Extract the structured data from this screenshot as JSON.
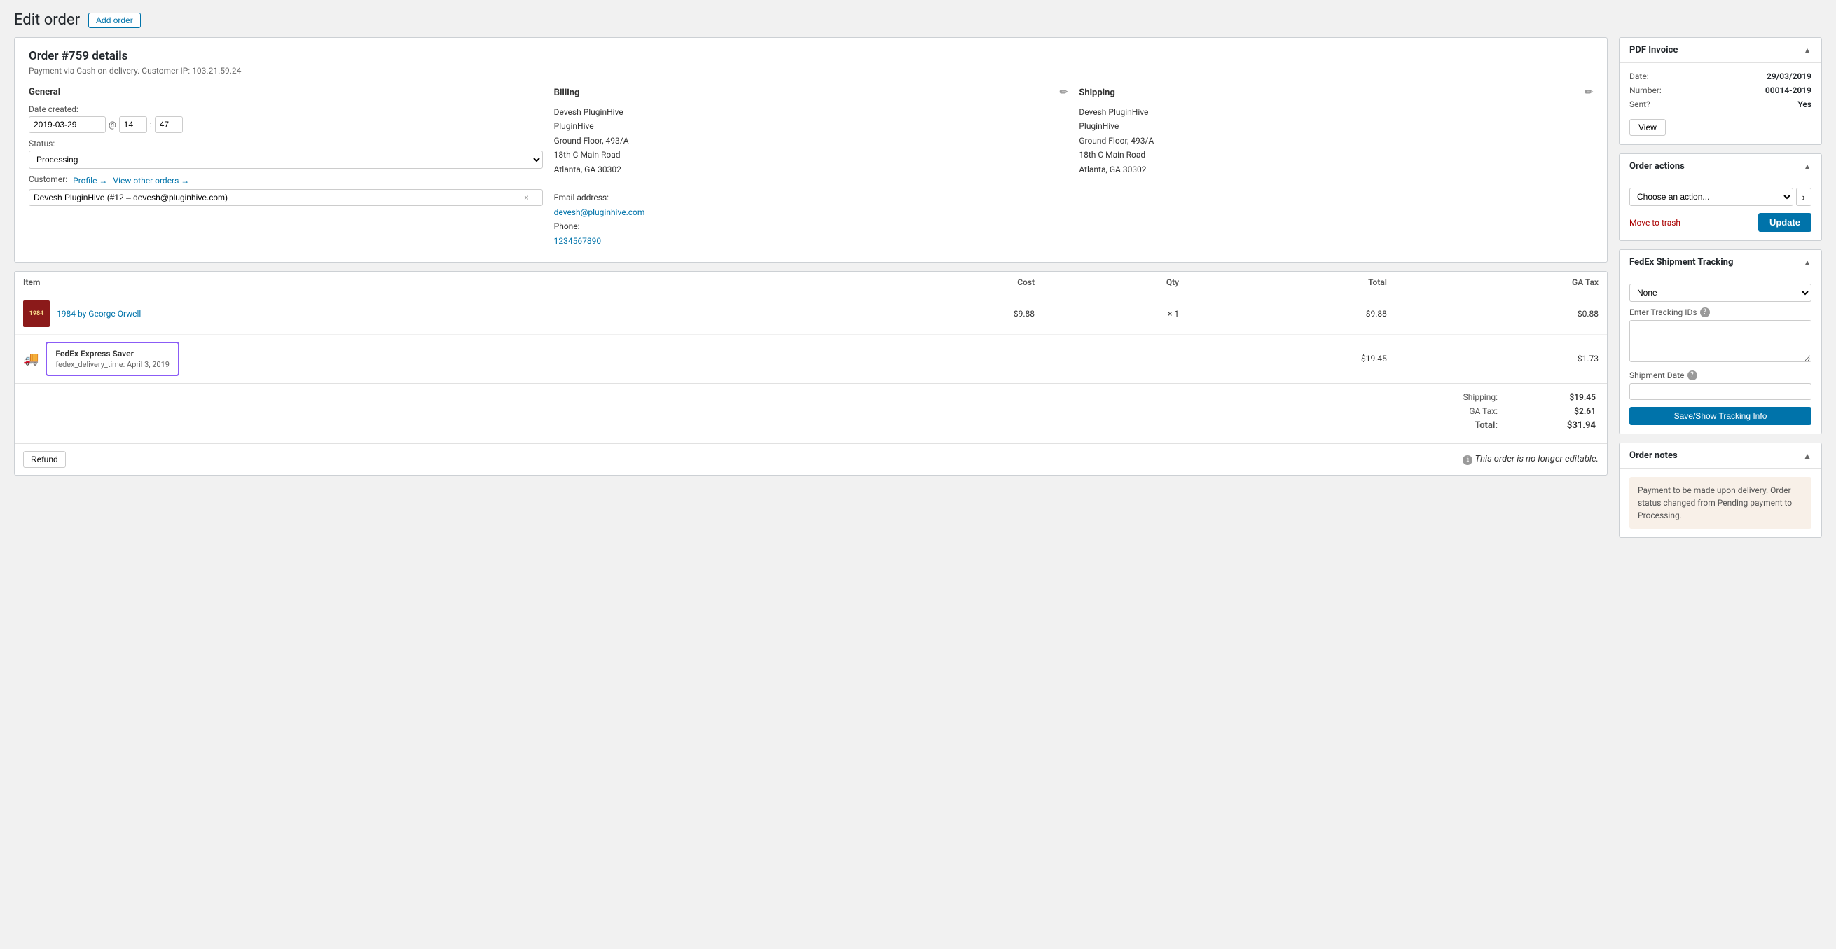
{
  "page": {
    "title": "Edit order",
    "add_order_btn": "Add order"
  },
  "order": {
    "title": "Order #759 details",
    "subtitle": "Payment via Cash on delivery. Customer IP: 103.21.59.24",
    "general": {
      "label": "General",
      "date_label": "Date created:",
      "date_value": "2019-03-29",
      "time_h": "14",
      "time_m": "47",
      "status_label": "Status:",
      "status_value": "Processing",
      "customer_label": "Customer:",
      "profile_link": "Profile →",
      "view_orders_link": "View other orders →",
      "customer_value": "Devesh PluginHive (#12 – devesh@pluginhive.com)"
    },
    "billing": {
      "label": "Billing",
      "name": "Devesh PluginHive",
      "company": "PluginHive",
      "address1": "Ground Floor, 493/A",
      "address2": "18th C Main Road",
      "city_state": "Atlanta, GA 30302",
      "email_label": "Email address:",
      "email": "devesh@pluginhive.com",
      "phone_label": "Phone:",
      "phone": "1234567890"
    },
    "shipping": {
      "label": "Shipping",
      "name": "Devesh PluginHive",
      "company": "PluginHive",
      "address1": "Ground Floor, 493/A",
      "address2": "18th C Main Road",
      "city_state": "Atlanta, GA 30302"
    }
  },
  "items": {
    "columns": {
      "item": "Item",
      "cost": "Cost",
      "qty": "Qty",
      "total": "Total",
      "ga_tax": "GA Tax"
    },
    "products": [
      {
        "name": "1984 by George Orwell",
        "cost": "$9.88",
        "qty": "× 1",
        "total": "$9.88",
        "ga_tax": "$0.88",
        "thumb_text": "1984"
      }
    ],
    "shipping_method": {
      "name": "FedEx Express Saver",
      "meta": "fedex_delivery_time: April 3, 2019",
      "cost": "$19.45",
      "ga_tax": "$1.73"
    },
    "totals": {
      "shipping_label": "Shipping:",
      "shipping_value": "$19.45",
      "ga_tax_label": "GA Tax:",
      "ga_tax_value": "$2.61",
      "total_label": "Total:",
      "total_value": "$31.94"
    },
    "refund_btn": "Refund",
    "not_editable": "This order is no longer editable."
  },
  "pdf_invoice": {
    "title": "PDF Invoice",
    "date_label": "Date:",
    "date_value": "29/03/2019",
    "number_label": "Number:",
    "number_value": "00014-2019",
    "sent_label": "Sent?",
    "sent_value": "Yes",
    "view_btn": "View"
  },
  "order_actions": {
    "title": "Order actions",
    "select_placeholder": "Choose an action...",
    "move_to_trash": "Move to trash",
    "update_btn": "Update"
  },
  "fedex_tracking": {
    "title": "FedEx Shipment Tracking",
    "select_value": "None",
    "tracking_ids_label": "Enter Tracking IDs",
    "shipment_date_label": "Shipment Date",
    "save_btn": "Save/Show Tracking Info"
  },
  "order_notes": {
    "title": "Order notes",
    "note": "Payment to be made upon delivery. Order status changed from Pending payment to Processing."
  }
}
